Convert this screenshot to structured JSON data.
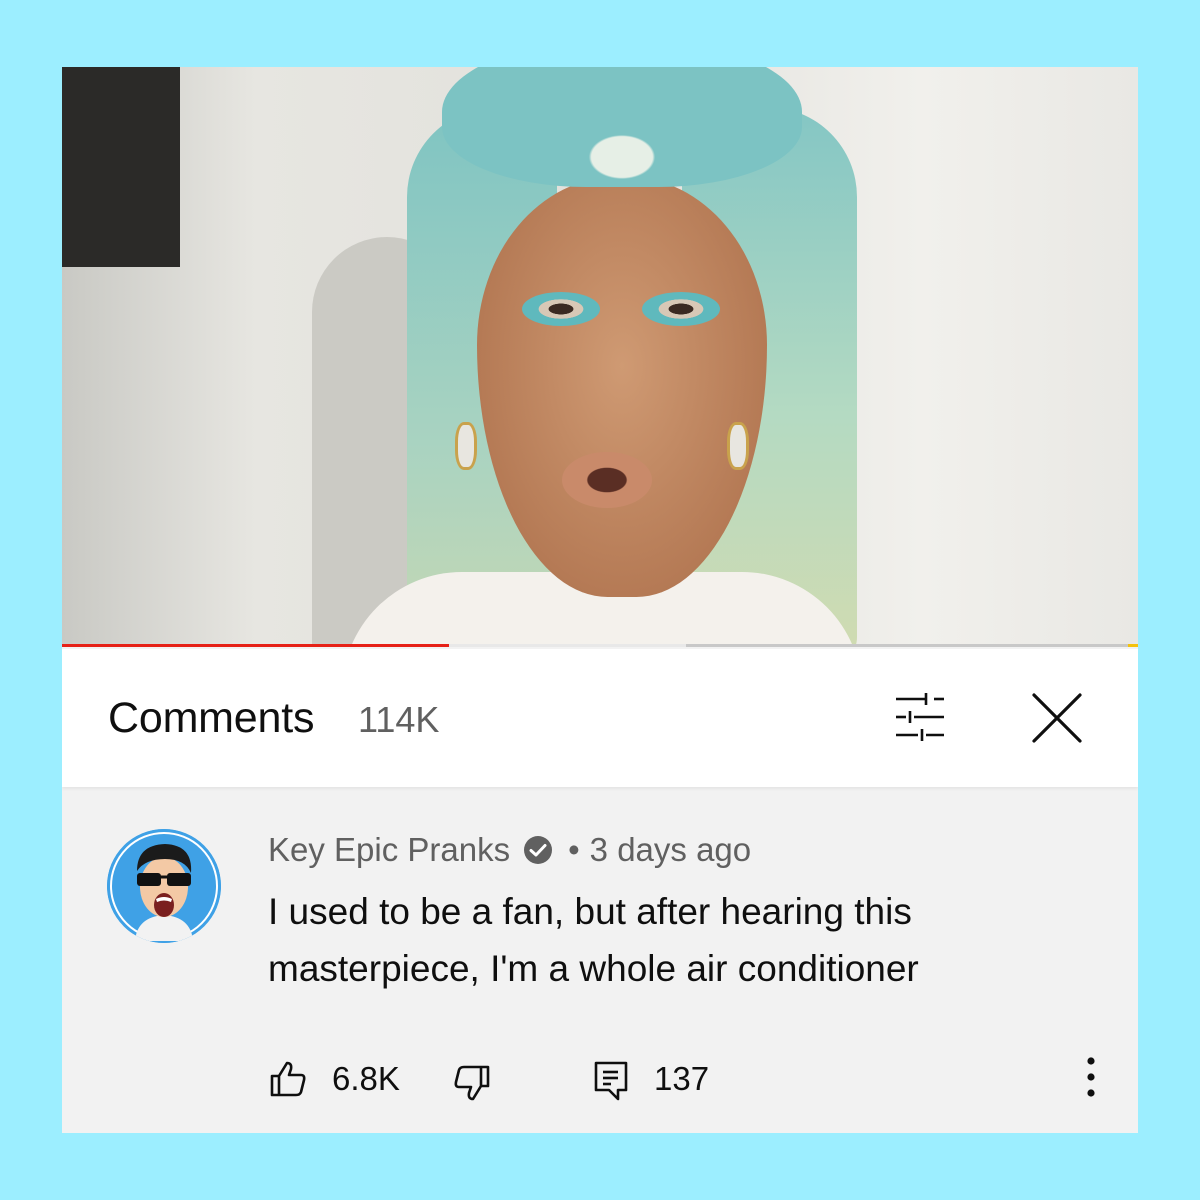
{
  "colors": {
    "page_background": "#9ceeff",
    "progress_played": "#e62117",
    "text_primary": "#0f0f0f",
    "text_secondary": "#606060"
  },
  "video": {
    "progress_played_fraction": 0.36,
    "progress_buffered_fraction": 0.58
  },
  "comments_header": {
    "title": "Comments",
    "count": "114K",
    "sort_icon": "sliders-icon",
    "close_icon": "close-icon"
  },
  "comment": {
    "author": "Key Epic Pranks",
    "verified_icon": "verified-check-icon",
    "separator": "•",
    "time": "3 days ago",
    "text": "I used to be a fan, but after hearing this masterpiece, I'm a whole air conditioner",
    "likes": "6.8K",
    "replies": "137",
    "like_icon": "thumbs-up-icon",
    "dislike_icon": "thumbs-down-icon",
    "reply_icon": "reply-comment-icon",
    "more_icon": "more-vertical-icon"
  }
}
